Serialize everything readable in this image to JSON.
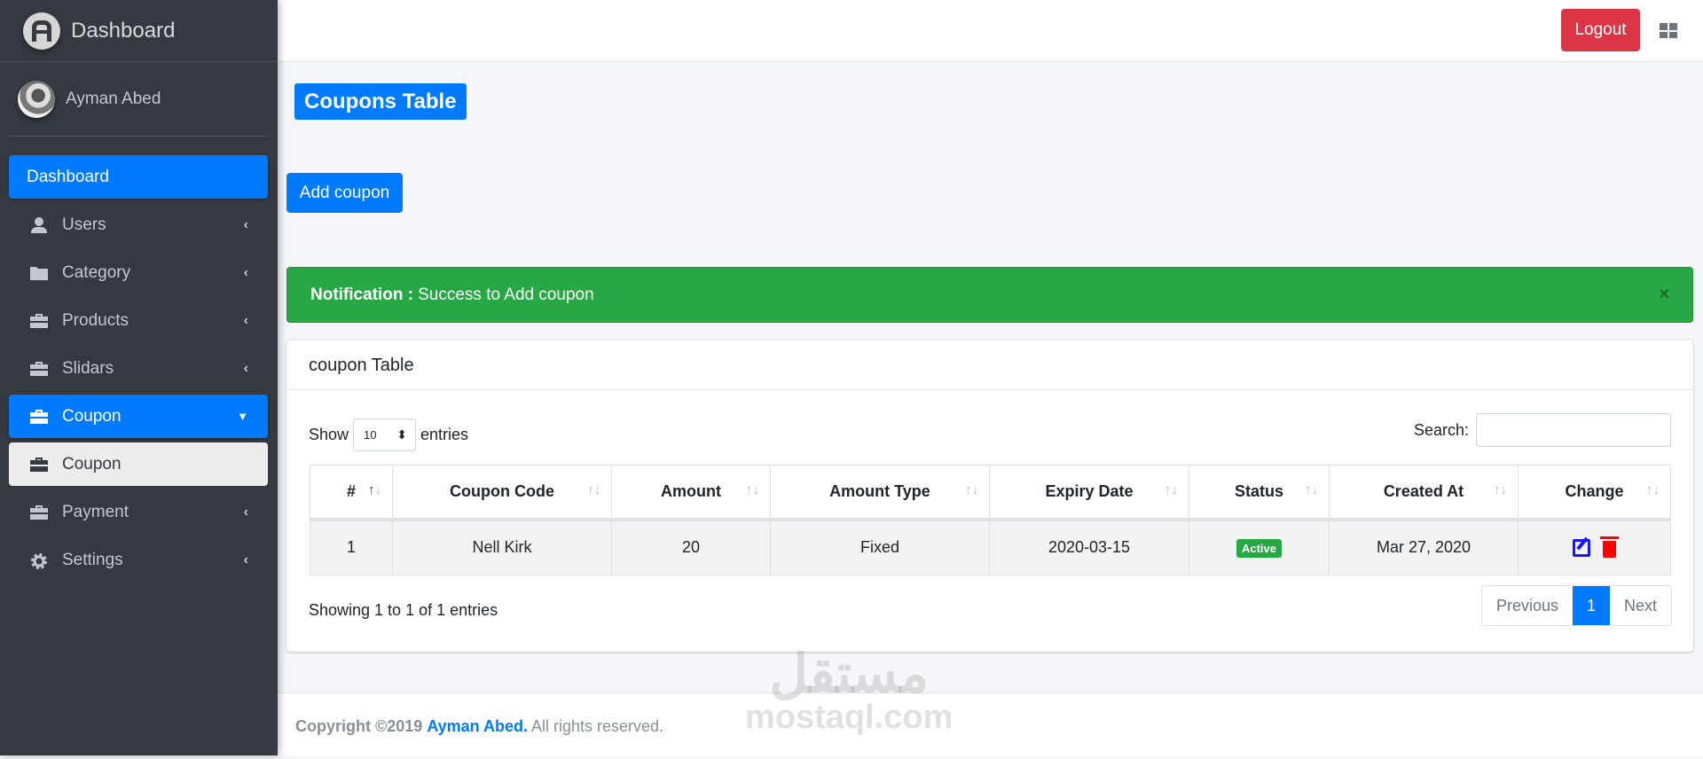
{
  "sidebar": {
    "brand": "Dashboard",
    "user": "Ayman Abed",
    "items": [
      {
        "label": "Dashboard"
      },
      {
        "label": "Users"
      },
      {
        "label": "Category"
      },
      {
        "label": "Products"
      },
      {
        "label": "Slidars"
      },
      {
        "label": "Coupon"
      },
      {
        "label": "Coupon"
      },
      {
        "label": "Payment"
      },
      {
        "label": "Settings"
      }
    ]
  },
  "topbar": {
    "logout": "Logout"
  },
  "page": {
    "title": "Coupons Table",
    "add_button": "Add coupon"
  },
  "alert": {
    "label": "Notification :",
    "message": "Success to Add coupon",
    "close": "×"
  },
  "card": {
    "title": "coupon Table",
    "show": "Show",
    "entries_value": "10",
    "entries": "entries",
    "search_label": "Search:",
    "columns": [
      "#",
      "Coupon Code",
      "Amount",
      "Amount Type",
      "Expiry Date",
      "Status",
      "Created At",
      "Change"
    ],
    "rows": [
      {
        "id": "1",
        "code": "Nell Kirk",
        "amount": "20",
        "type": "Fixed",
        "expiry": "2020-03-15",
        "status": "Active",
        "created": "Mar 27, 2020"
      }
    ],
    "showing": "Showing 1 to 1 of 1 entries",
    "pagination": {
      "previous": "Previous",
      "current": "1",
      "next": "Next"
    }
  },
  "footer": {
    "copyright": "Copyright ©2019",
    "author": "Ayman Abed.",
    "rights": "All rights reserved."
  },
  "watermark": {
    "arabic": "مستقل",
    "latin": "mostaql.com"
  },
  "colors": {
    "primary": "#007bff",
    "success": "#28a745",
    "danger": "#dc3545",
    "sidebar": "#343a40"
  }
}
